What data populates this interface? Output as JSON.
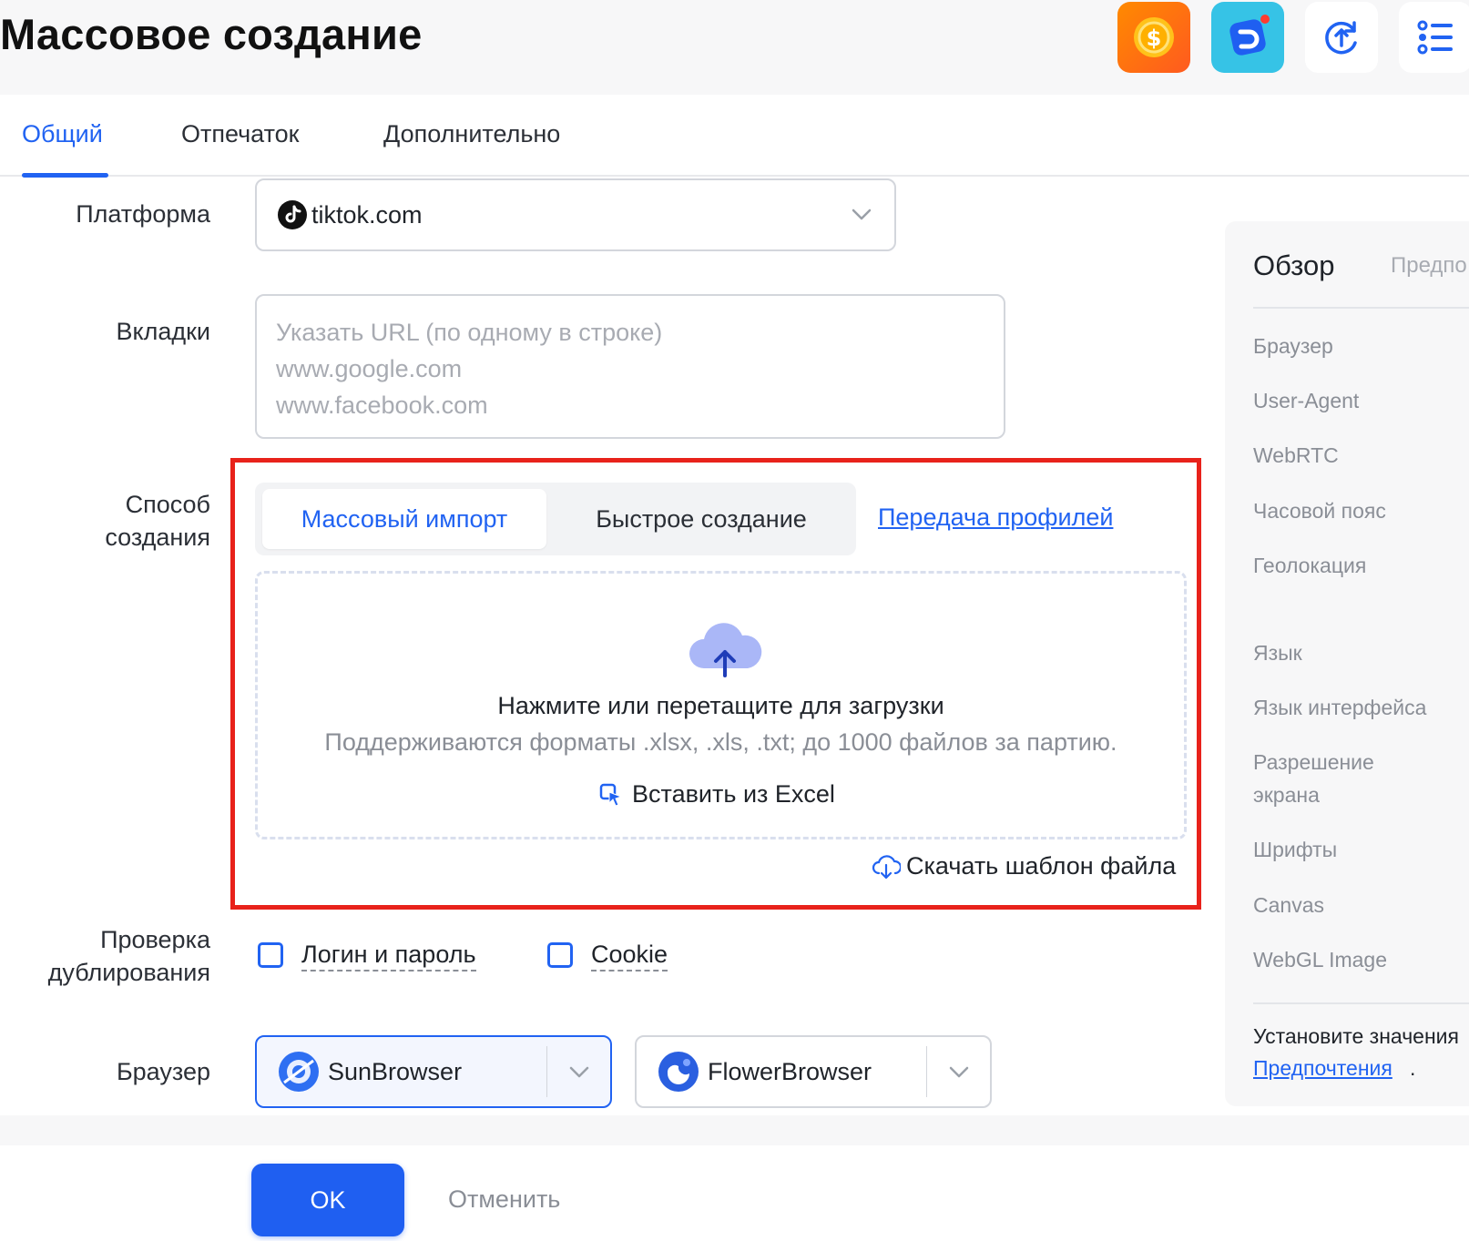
{
  "header": {
    "title": "Массовое создание"
  },
  "tabs": [
    {
      "label": "Общий"
    },
    {
      "label": "Отпечаток"
    },
    {
      "label": "Дополнительно"
    }
  ],
  "form": {
    "platform": {
      "label": "Платформа",
      "value": "tiktok.com"
    },
    "tabs_field": {
      "label": "Вкладки",
      "placeholder": [
        "Указать URL (по одному в строке)",
        "www.google.com",
        "www.facebook.com"
      ]
    },
    "method": {
      "label_line1": "Способ",
      "label_line2": "создания",
      "options": [
        "Массовый импорт",
        "Быстрое создание"
      ],
      "transfer_link": "Передача профилей"
    },
    "upload": {
      "title": "Нажмите или перетащите для загрузки",
      "subtitle": "Поддерживаются форматы .xlsx, .xls, .txt; до 1000 файлов за партию.",
      "paste": "Вставить из Excel",
      "download_template": "Скачать шаблон файла"
    },
    "dup_check": {
      "label_line1": "Проверка",
      "label_line2": "дублирования",
      "options": [
        "Логин и пароль",
        "Cookie"
      ]
    },
    "browser": {
      "label": "Браузер",
      "options": [
        "SunBrowser",
        "FlowerBrowser"
      ]
    }
  },
  "footer": {
    "ok": "OK",
    "cancel": "Отменить"
  },
  "side_panel": {
    "title": "Обзор",
    "preview": "Предпо",
    "items": [
      "Браузер",
      "User-Agent",
      "WebRTC",
      "Часовой пояс",
      "Геолокация",
      "Язык",
      "Язык интерфейса",
      "Разрешение",
      "экрана",
      "Шрифты",
      "Canvas",
      "WebGL Image"
    ],
    "hint": "Установите значения",
    "link": "Предпочтения",
    "dot": "."
  },
  "colors": {
    "accent": "#2163f2",
    "highlight": "#e8221b",
    "ok": "#1f5ff1"
  }
}
